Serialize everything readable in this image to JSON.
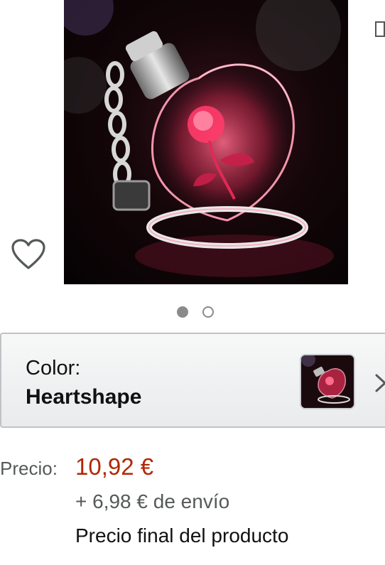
{
  "product": {
    "image_alt": "Heart-shaped crystal keychain with red rose",
    "image_count": 2,
    "active_image": 1
  },
  "icons": {
    "wishlist": "heart-outline-icon",
    "share": "share-icon",
    "chevron": "chevron-right-icon"
  },
  "variation": {
    "label": "Color:",
    "value": "Heartshape"
  },
  "price": {
    "label": "Precio:",
    "value": "10,92 €",
    "shipping": "+ 6,98 € de envío",
    "final_note": "Precio final del producto"
  },
  "colors": {
    "price": "#b12704",
    "secondary_text": "#565959",
    "dot": "#8a8a8a",
    "border": "#bfc3c6"
  }
}
